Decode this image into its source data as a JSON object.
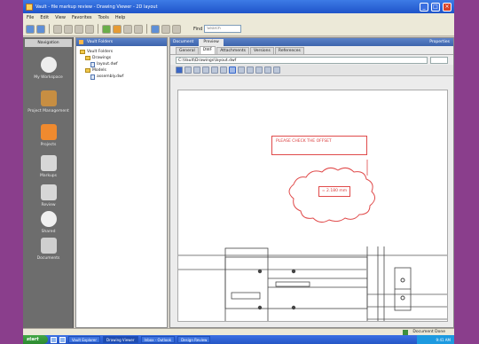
{
  "window": {
    "title": "Vault - file markup review - Drawing Viewer - 2D layout",
    "minimize": "_",
    "maximize": "□",
    "close": "×"
  },
  "menu": [
    "File",
    "Edit",
    "View",
    "Favorites",
    "Tools",
    "Help"
  ],
  "toolbar": {
    "search_label": "Find",
    "search_placeholder": "Search"
  },
  "rail": {
    "tab": "Navigation",
    "items": [
      {
        "label": "My Workspace",
        "icon": "globe-icon",
        "color": "#ededed"
      },
      {
        "label": "Project Management",
        "icon": "briefcase-icon",
        "color": "#c78e42"
      },
      {
        "label": "Projects",
        "icon": "folder-icon",
        "color": "#ef8a2f"
      },
      {
        "label": "Markups",
        "icon": "pencil-icon",
        "color": "#d7d7d7"
      },
      {
        "label": "Review",
        "icon": "binoculars-icon",
        "color": "#d7d7d7"
      },
      {
        "label": "Shared",
        "icon": "cloud-icon",
        "color": "#f0f0f0"
      },
      {
        "label": "Documents",
        "icon": "document-icon",
        "color": "#cfcfcf"
      }
    ]
  },
  "tree": {
    "header": "Vault Folders",
    "nodes": [
      {
        "label": "Vault Folders",
        "level": 0,
        "kind": "folder"
      },
      {
        "label": "Drawings",
        "level": 1,
        "kind": "folder"
      },
      {
        "label": "layout.dwf",
        "level": 2,
        "kind": "doc"
      },
      {
        "label": "Models",
        "level": 1,
        "kind": "folder"
      },
      {
        "label": "assembly.dwf",
        "level": 2,
        "kind": "doc"
      }
    ]
  },
  "viewer": {
    "tab_label": "Preview",
    "other_tab": "Properties",
    "side_label": "Document",
    "subtabs": [
      "General",
      "DWF",
      "Attachments",
      "Versions",
      "References"
    ],
    "active_subtab": 1,
    "file_path": "C:\\Vault\\Drawings\\layout.dwf",
    "callout_text": "PLEASE CHECK THE OFFSET",
    "cloud_text": "= 2.180 mm"
  },
  "status": {
    "text": "Document Done"
  },
  "taskbar": {
    "start": "start",
    "tasks": [
      {
        "label": "Vault Explorer",
        "active": false
      },
      {
        "label": "Drawing Viewer",
        "active": true
      },
      {
        "label": "Inbox - Outlook",
        "active": false
      },
      {
        "label": "Design Review",
        "active": false
      }
    ],
    "clock": "9:41 AM"
  },
  "colors": {
    "markup_red": "#e04a4a",
    "title_blue": "#1f54c9"
  }
}
